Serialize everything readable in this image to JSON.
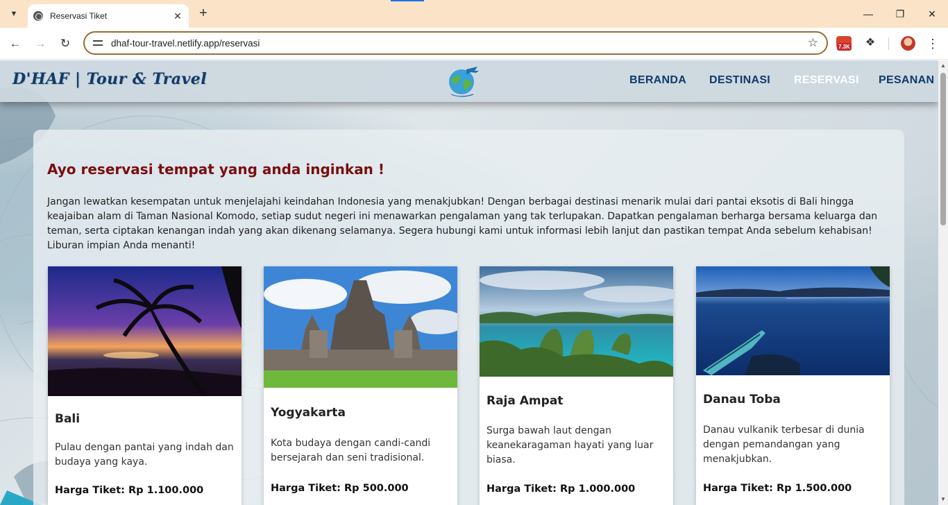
{
  "browser": {
    "tab_title": "Reservasi Tiket",
    "url": "dhaf-tour-travel.netlify.app/reservasi",
    "extension_badge": "7.3K"
  },
  "site": {
    "brand": "D'HAF | Tour & Travel",
    "nav": [
      "BERANDA",
      "DESTINASI",
      "RESERVASI",
      "PESANAN"
    ],
    "active_nav": "RESERVASI"
  },
  "main": {
    "heading": "Ayo reservasi tempat yang anda inginkan !",
    "intro": "Jangan lewatkan kesempatan untuk menjelajahi keindahan Indonesia yang menakjubkan! Dengan berbagai destinasi menarik mulai dari pantai eksotis di Bali hingga keajaiban alam di Taman Nasional Komodo, setiap sudut negeri ini menawarkan pengalaman yang tak terlupakan. Dapatkan pengalaman berharga bersama keluarga dan teman, serta ciptakan kenangan indah yang akan dikenang selamanya. Segera hubungi kami untuk informasi lebih lanjut dan pastikan tempat Anda sebelum kehabisan! Liburan impian Anda menanti!",
    "destinations": [
      {
        "name": "Bali",
        "description": "Pulau dengan pantai yang indah dan budaya yang kaya.",
        "price": "Harga Tiket: Rp 1.100.000"
      },
      {
        "name": "Yogyakarta",
        "description": "Kota budaya dengan candi-candi bersejarah dan seni tradisional.",
        "price": "Harga Tiket: Rp 500.000"
      },
      {
        "name": "Raja Ampat",
        "description": "Surga bawah laut dengan keanekaragaman hayati yang luar biasa.",
        "price": "Harga Tiket: Rp 1.000.000"
      },
      {
        "name": "Danau Toba",
        "description": "Danau vulkanik terbesar di dunia dengan pemandangan yang menakjubkan.",
        "price": "Harga Tiket: Rp 1.500.000"
      }
    ]
  },
  "colors": {
    "tabbar": "#fbe3c8",
    "heading": "#7a0e0e",
    "nav_text": "#0f3b6b",
    "nav_active": "#ffffff"
  }
}
